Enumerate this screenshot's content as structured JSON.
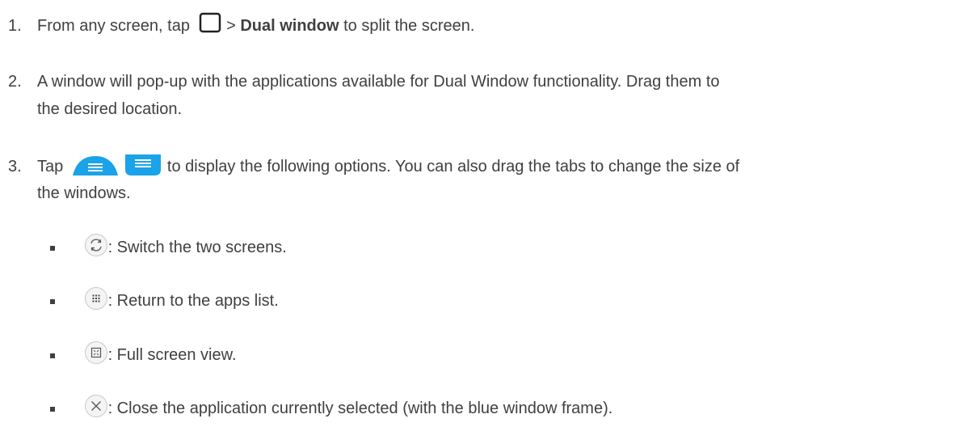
{
  "steps": [
    {
      "num": "1.",
      "pre": "From any screen, tap",
      "mid": " > ",
      "bold": "Dual window",
      "post": " to split the screen.",
      "icon": "recent-apps-square-icon"
    },
    {
      "num": "2.",
      "line1": "A window will pop-up with the applications available for Dual Window functionality. Drag them to",
      "line2": "the desired location."
    },
    {
      "num": "3.",
      "pre": "Tap",
      "line1_post": " to display the following options. You can also drag the tabs to change the size of",
      "line2": "the windows.",
      "icons": [
        "dual-window-tab-icon",
        "dual-window-menu-icon"
      ],
      "accent": "#1aa3e8"
    }
  ],
  "options": [
    {
      "icon": "switch-icon",
      "text": ": Switch the two screens."
    },
    {
      "icon": "apps-grid-icon",
      "text": ": Return to the apps list."
    },
    {
      "icon": "fullscreen-icon",
      "text": ": Full screen view."
    },
    {
      "icon": "close-icon",
      "text": ": Close the application currently selected (with the blue window frame)."
    }
  ]
}
